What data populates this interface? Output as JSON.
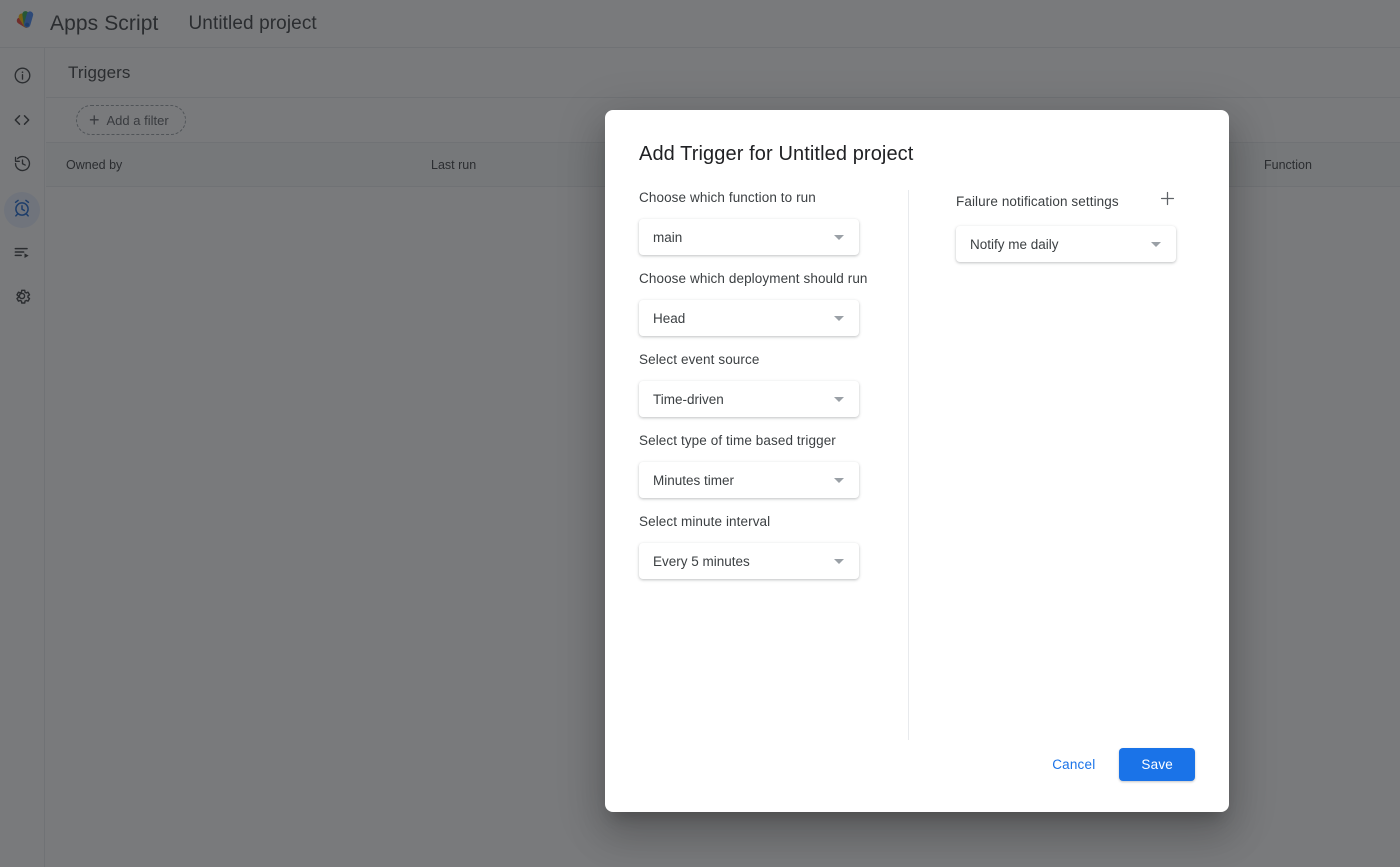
{
  "topbar": {
    "logo_icon": "apps-script-logo",
    "brand": "Apps Script",
    "project_title": "Untitled project"
  },
  "sidebar": {
    "items": [
      {
        "icon": "info-icon",
        "name": "overview",
        "active": false
      },
      {
        "icon": "code-icon",
        "name": "editor",
        "active": false
      },
      {
        "icon": "history-icon",
        "name": "deployments",
        "active": false
      },
      {
        "icon": "alarm-clock-icon",
        "name": "triggers",
        "active": true
      },
      {
        "icon": "executions-icon",
        "name": "executions",
        "active": false
      },
      {
        "icon": "gear-icon",
        "name": "settings",
        "active": false
      }
    ]
  },
  "page": {
    "title": "Triggers",
    "filter_button": {
      "label": "Add a filter",
      "icon": "plus-icon"
    },
    "table_headers": {
      "owned_by": "Owned by",
      "last_run": "Last run",
      "function": "Function"
    }
  },
  "dialog": {
    "title": "Add Trigger for Untitled project",
    "left_fields": [
      {
        "label": "Choose which function to run",
        "value": "main",
        "name": "function-select"
      },
      {
        "label": "Choose which deployment should run",
        "value": "Head",
        "name": "deployment-select"
      },
      {
        "label": "Select event source",
        "value": "Time-driven",
        "name": "event-source-select"
      },
      {
        "label": "Select type of time based trigger",
        "value": "Minutes timer",
        "name": "time-trigger-type-select"
      },
      {
        "label": "Select minute interval",
        "value": "Every 5 minutes",
        "name": "minute-interval-select"
      }
    ],
    "right_section": {
      "label": "Failure notification settings",
      "add_icon": "plus-icon",
      "field": {
        "value": "Notify me daily",
        "name": "failure-notification-select"
      }
    },
    "footer": {
      "cancel_label": "Cancel",
      "save_label": "Save"
    }
  },
  "colors": {
    "accent_blue": "#1a73e8",
    "active_nav_blue": "#1967d2",
    "active_nav_bg": "#e8f0fe",
    "text_primary": "#202124",
    "text_secondary": "#3c4043",
    "text_muted": "#5f6368",
    "border": "#e8eaed",
    "scrim": "rgba(32,33,36,0.6)"
  }
}
